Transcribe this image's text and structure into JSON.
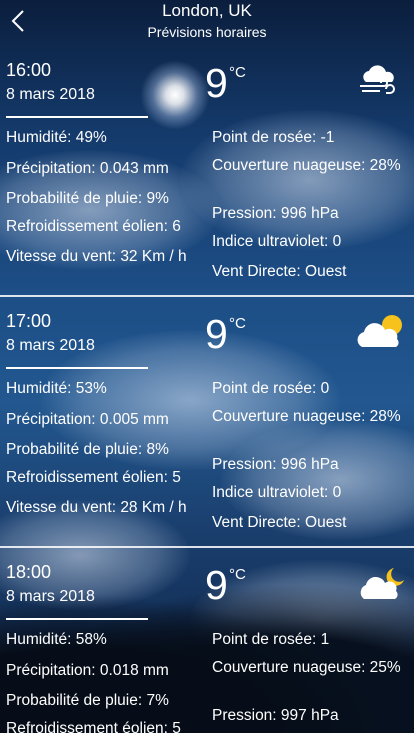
{
  "header": {
    "title": "London, UK",
    "subtitle": "Prévisions horaires",
    "back_icon": "chevron-left-icon"
  },
  "hours": [
    {
      "time": "16:00",
      "date": "8 mars 2018",
      "temp": "9",
      "unit": "°C",
      "icon": "cloud-wind-icon",
      "humidity": "Humidité: 49%",
      "precip": "Précipitation: 0.043 mm",
      "rain_prob": "Probabilité de pluie: 9%",
      "windchill": "Refroidissement éolien: 6",
      "wind_speed": "Vitesse du vent: 32 Km / h",
      "dewpoint": "Point de rosée: -1",
      "cloud_cover": "Couverture nuageuse: 28%",
      "pressure": "Pression: 996 hPa",
      "uv": "Indice ultraviolet: 0",
      "wind_dir": "Vent Directe: Ouest"
    },
    {
      "time": "17:00",
      "date": "8 mars 2018",
      "temp": "9",
      "unit": "°C",
      "icon": "cloud-sun-icon",
      "humidity": "Humidité: 53%",
      "precip": "Précipitation: 0.005 mm",
      "rain_prob": "Probabilité de pluie: 8%",
      "windchill": "Refroidissement éolien: 5",
      "wind_speed": "Vitesse du vent: 28 Km / h",
      "dewpoint": "Point de rosée: 0",
      "cloud_cover": "Couverture nuageuse: 28%",
      "pressure": "Pression: 996 hPa",
      "uv": "Indice ultraviolet: 0",
      "wind_dir": "Vent Directe: Ouest"
    },
    {
      "time": "18:00",
      "date": "8 mars 2018",
      "temp": "9",
      "unit": "°C",
      "icon": "cloud-moon-icon",
      "humidity": "Humidité: 58%",
      "precip": "Précipitation: 0.018 mm",
      "rain_prob": "Probabilité de pluie: 7%",
      "windchill": "Refroidissement éolien: 5",
      "dewpoint": "Point de rosée: 1",
      "cloud_cover": "Couverture nuageuse: 25%",
      "pressure": "Pression: 997 hPa"
    }
  ]
}
